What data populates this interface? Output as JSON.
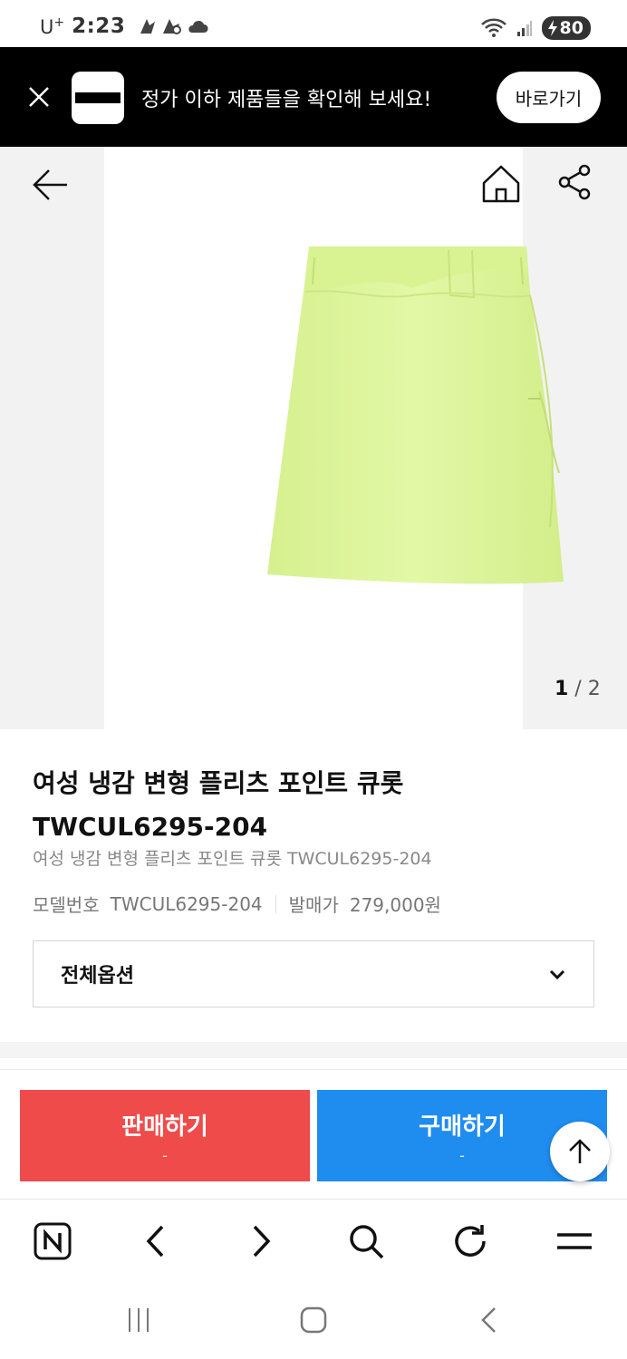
{
  "status_bar": {
    "carrier": "U",
    "carrier_sup": "+",
    "time": "2:23",
    "battery": "80"
  },
  "promo": {
    "text": "정가 이하 제품들을 확인해 보세요!",
    "button_label": "바로가기"
  },
  "gallery": {
    "current_page": "1",
    "separator": " / ",
    "total_pages": "2",
    "product_color": "#dcf59a"
  },
  "product": {
    "title_line1": "여성 냉감 변형 플리츠 포인트 큐롯",
    "title_line2": "TWCUL6295-204",
    "subtitle": "여성 냉감 변형 플리츠 포인트 큐롯 TWCUL6295-204",
    "model_label": "모델번호",
    "model_value": "TWCUL6295-204",
    "price_label": "발매가",
    "price_value": "279,000원",
    "option_label": "전체옵션"
  },
  "actions": {
    "sell_label": "판매하기",
    "sell_price": "-",
    "sell_color": "#ef4b4b",
    "buy_label": "구매하기",
    "buy_price": "-",
    "buy_color": "#1f8cf0"
  },
  "browser_toolbar": {
    "items": [
      "naver-n-icon",
      "back-icon",
      "forward-icon",
      "search-icon",
      "refresh-icon",
      "menu-icon"
    ]
  },
  "system_nav": {
    "items": [
      "recent-apps-icon",
      "home-icon",
      "back-icon"
    ]
  }
}
